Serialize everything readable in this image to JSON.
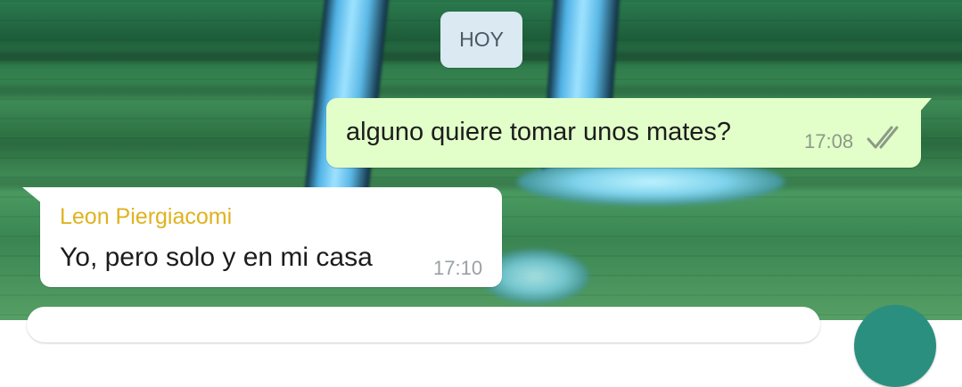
{
  "chat": {
    "date_separator": "HOY",
    "messages": [
      {
        "direction": "outgoing",
        "text": "alguno quiere tomar unos mates?",
        "time": "17:08",
        "status_icon": "double-check-icon"
      },
      {
        "direction": "incoming",
        "sender": "Leon Piergiacomi",
        "text": "Yo, pero solo y en mi casa",
        "time": "17:10"
      }
    ]
  },
  "colors": {
    "outgoing_bubble": "#e2ffc9",
    "incoming_bubble": "#ffffff",
    "sender_name": "#e0b21f",
    "date_chip": "#dbe9f2",
    "send_button": "#2a8f7f"
  }
}
